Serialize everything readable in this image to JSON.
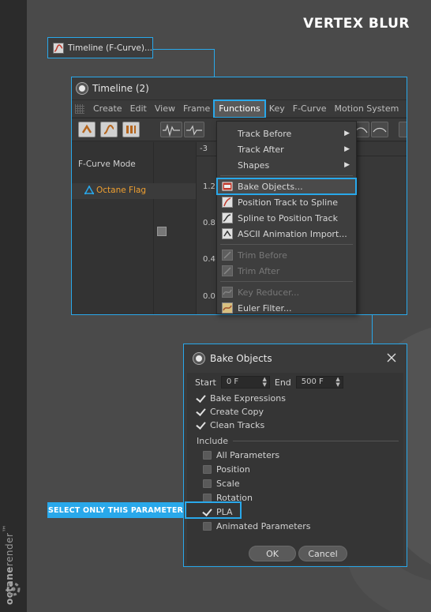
{
  "page": {
    "title": "VERTEX BLUR",
    "brand_bold": "octane",
    "brand_rest": "render",
    "brand_tm": "™"
  },
  "colors": {
    "accent": "#29a8ea",
    "background": "#4a4a4a",
    "strip": "#2b2b2b",
    "object": "#f0a030"
  },
  "launcher": {
    "label": "Timeline (F-Curve)...",
    "icon": "fcurve-icon"
  },
  "timeline": {
    "title": "Timeline (2)",
    "menu": [
      "Create",
      "Edit",
      "View",
      "Frame",
      "Functions",
      "Key",
      "F-Curve",
      "Motion System"
    ],
    "active_menu": "Functions",
    "mode_label": "F-Curve Mode",
    "object_name": "Octane Flag",
    "x_tick": "-3",
    "y_ticks": [
      "1.2",
      "0.8",
      "0.4",
      "0.0"
    ]
  },
  "functions_menu": {
    "items": [
      {
        "label": "Track Before",
        "submenu": true,
        "enabled": true,
        "icon": "none"
      },
      {
        "label": "Track After",
        "submenu": true,
        "enabled": true,
        "icon": "none"
      },
      {
        "label": "Shapes",
        "submenu": true,
        "enabled": true,
        "icon": "none"
      },
      {
        "label": "Bake Objects...",
        "submenu": false,
        "enabled": true,
        "icon": "bake-icon"
      },
      {
        "label": "Position Track to Spline",
        "submenu": false,
        "enabled": true,
        "icon": "track-spline-icon"
      },
      {
        "label": "Spline to Position Track",
        "submenu": false,
        "enabled": true,
        "icon": "spline-track-icon"
      },
      {
        "label": "ASCII Animation Import...",
        "submenu": false,
        "enabled": true,
        "icon": "ascii-import-icon"
      },
      {
        "label": "Trim Before",
        "submenu": false,
        "enabled": false,
        "icon": "trim-before-icon"
      },
      {
        "label": "Trim After",
        "submenu": false,
        "enabled": false,
        "icon": "trim-after-icon"
      },
      {
        "label": "Key Reducer...",
        "submenu": false,
        "enabled": false,
        "icon": "key-reducer-icon"
      },
      {
        "label": "Euler Filter...",
        "submenu": false,
        "enabled": true,
        "icon": "euler-filter-icon"
      }
    ]
  },
  "bake_dialog": {
    "title": "Bake Objects",
    "start_label": "Start",
    "start_value": "0 F",
    "end_label": "End",
    "end_value": "500 F",
    "options": [
      {
        "label": "Bake Expressions",
        "checked": true
      },
      {
        "label": "Create Copy",
        "checked": true
      },
      {
        "label": "Clean Tracks",
        "checked": true
      }
    ],
    "include_label": "Include",
    "include": [
      {
        "label": "All Parameters",
        "checked": false
      },
      {
        "label": "Position",
        "checked": false
      },
      {
        "label": "Scale",
        "checked": false
      },
      {
        "label": "Rotation",
        "checked": false
      },
      {
        "label": "PLA",
        "checked": true
      },
      {
        "label": "Animated Parameters",
        "checked": false
      }
    ],
    "ok_label": "OK",
    "cancel_label": "Cancel"
  },
  "callout": {
    "text": "SELECT ONLY THIS PARAMETER"
  }
}
